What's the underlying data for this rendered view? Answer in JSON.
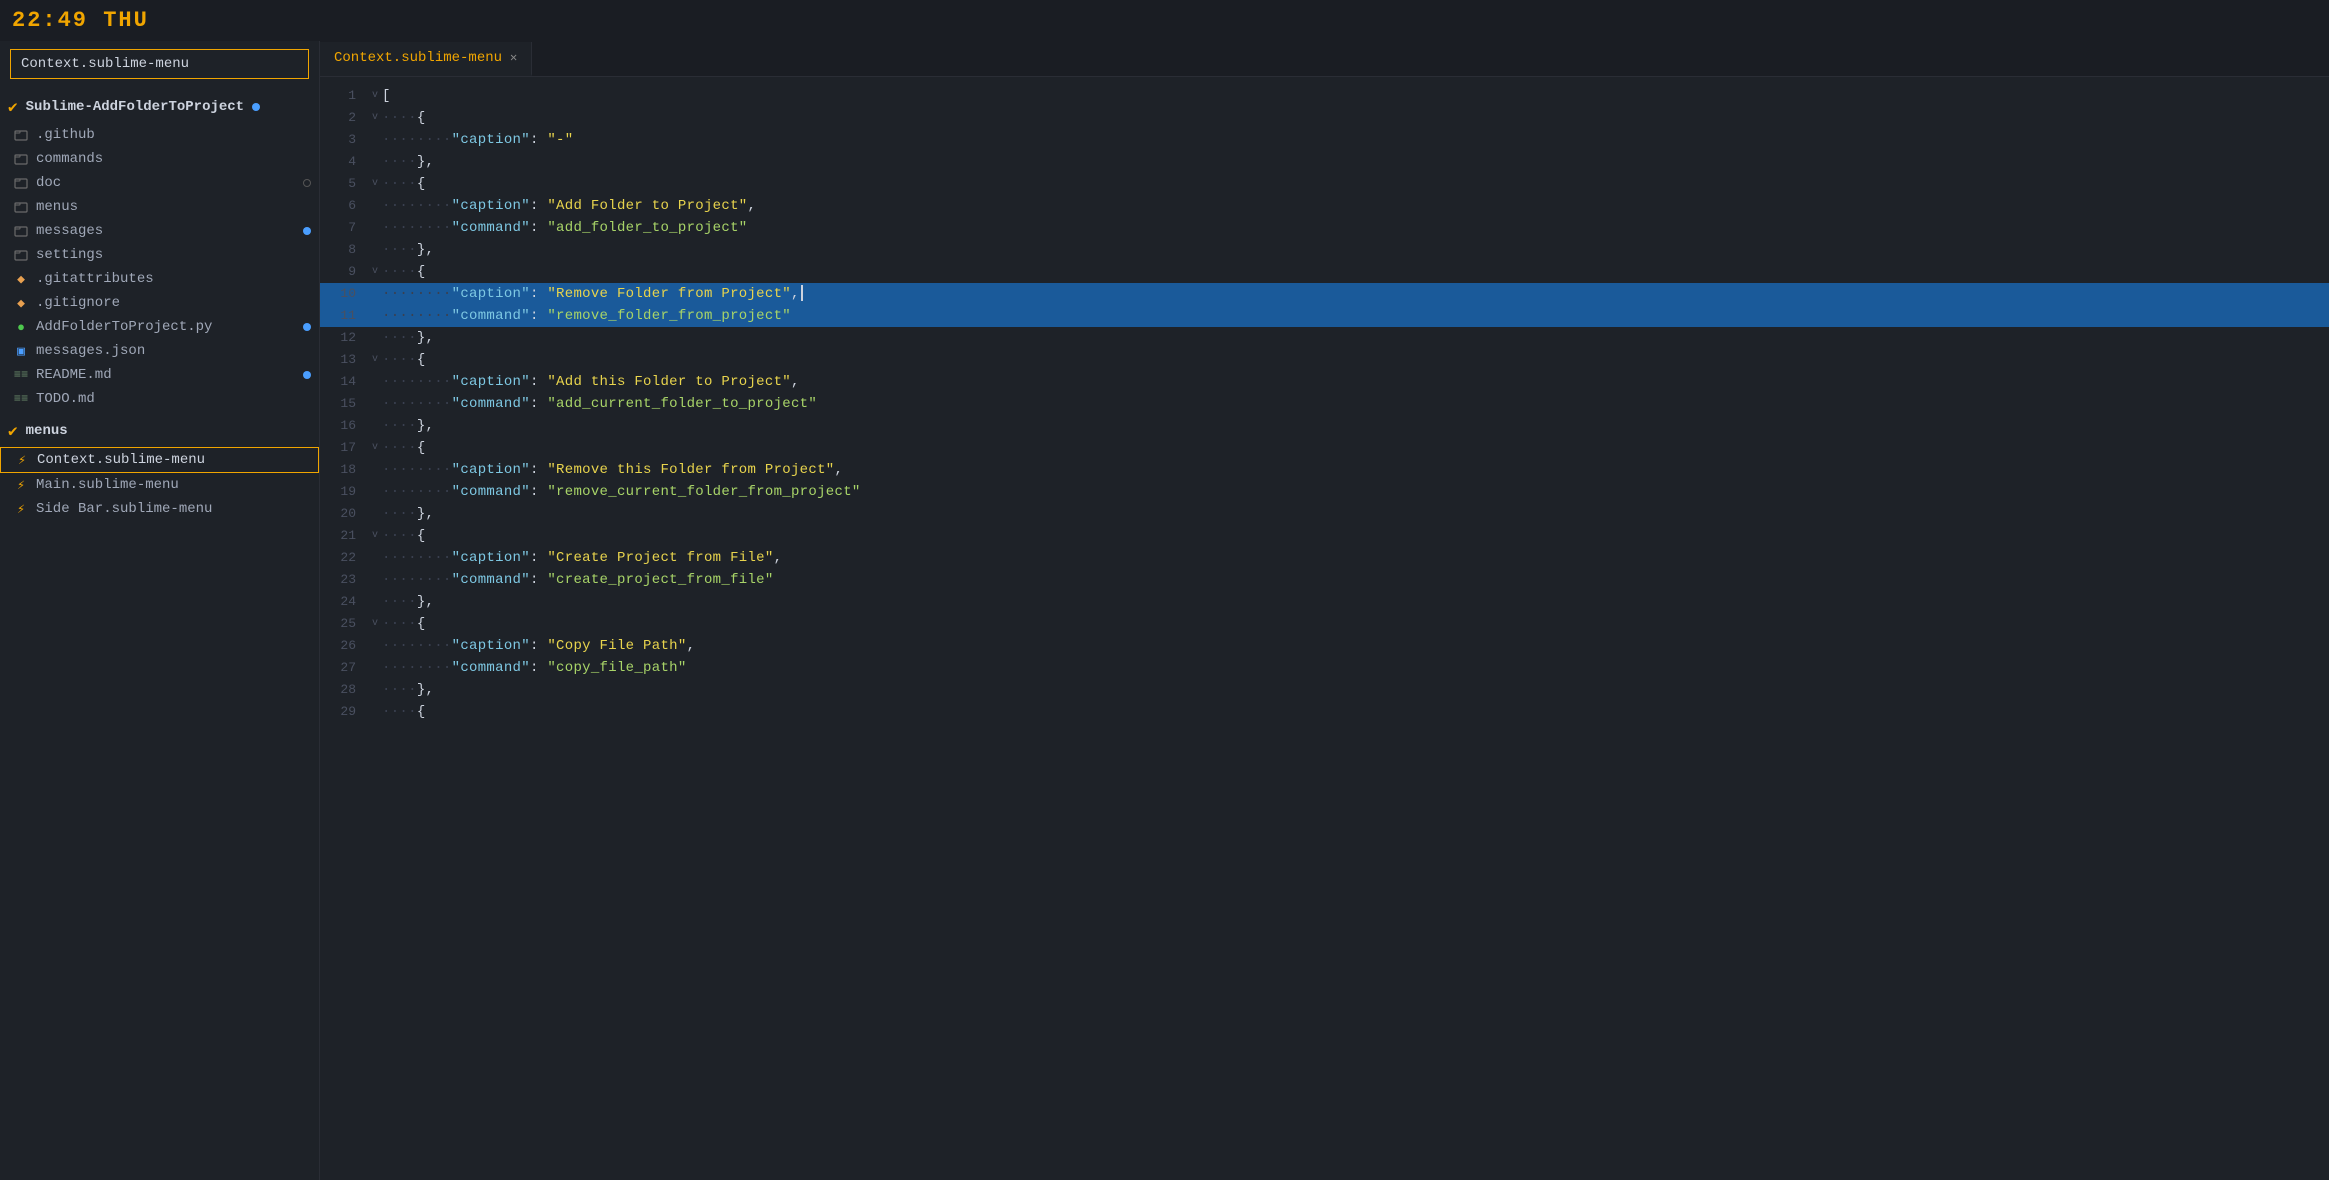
{
  "topbar": {
    "clock": "22:49 THU"
  },
  "sidebar": {
    "search_placeholder": "Context.sublime-menu",
    "search_value": "Context.sublime-menu",
    "root_folder": {
      "name": "Sublime-AddFolderToProject",
      "has_badge": true
    },
    "files": [
      {
        "id": "github",
        "type": "folder-square",
        "label": ".github",
        "indent": 1,
        "badge": null
      },
      {
        "id": "commands",
        "type": "folder-square",
        "label": "commands",
        "indent": 1,
        "badge": null
      },
      {
        "id": "doc",
        "type": "folder-square",
        "label": "doc",
        "indent": 1,
        "badge": "empty"
      },
      {
        "id": "menus",
        "type": "folder-square",
        "label": "menus",
        "indent": 1,
        "badge": null
      },
      {
        "id": "messages",
        "type": "folder-square",
        "label": "messages",
        "indent": 1,
        "badge": "blue"
      },
      {
        "id": "settings",
        "type": "folder-square",
        "label": "settings",
        "indent": 1,
        "badge": null
      },
      {
        "id": "gitattributes",
        "type": "git",
        "label": ".gitattributes",
        "indent": 1,
        "badge": null
      },
      {
        "id": "gitignore",
        "type": "git",
        "label": ".gitignore",
        "indent": 1,
        "badge": null
      },
      {
        "id": "addfolder-py",
        "type": "python",
        "label": "AddFolderToProject.py",
        "indent": 1,
        "badge": "blue"
      },
      {
        "id": "messages-json",
        "type": "json",
        "label": "messages.json",
        "indent": 1,
        "badge": null
      },
      {
        "id": "readme",
        "type": "md",
        "label": "README.md",
        "indent": 1,
        "badge": "blue"
      },
      {
        "id": "todo",
        "type": "md",
        "label": "TODO.md",
        "indent": 1,
        "badge": null
      }
    ],
    "menus_section": {
      "name": "menus"
    },
    "menu_files": [
      {
        "id": "context-menu",
        "label": "Context.sublime-menu",
        "active": true
      },
      {
        "id": "main-menu",
        "label": "Main.sublime-menu",
        "active": false
      },
      {
        "id": "sidebar-menu",
        "label": "Side Bar.sublime-menu",
        "active": false
      }
    ]
  },
  "tabs": [
    {
      "id": "context-tab",
      "label": "Context.sublime-menu",
      "active": true,
      "closable": true
    }
  ],
  "code_lines": [
    {
      "num": 1,
      "fold": "v",
      "content": "[",
      "highlight": false,
      "tokens": [
        {
          "t": "bracket",
          "v": "["
        }
      ]
    },
    {
      "num": 2,
      "fold": "v",
      "content": "    {",
      "highlight": false
    },
    {
      "num": 3,
      "fold": null,
      "content": "        \"caption\": \"-\"",
      "highlight": false
    },
    {
      "num": 4,
      "fold": null,
      "content": "    },",
      "highlight": false
    },
    {
      "num": 5,
      "fold": "v",
      "content": "    {",
      "highlight": false
    },
    {
      "num": 6,
      "fold": null,
      "content": "        \"caption\": \"Add Folder to Project\",",
      "highlight": false
    },
    {
      "num": 7,
      "fold": null,
      "content": "        \"command\": \"add_folder_to_project\"",
      "highlight": false
    },
    {
      "num": 8,
      "fold": null,
      "content": "    },",
      "highlight": false
    },
    {
      "num": 9,
      "fold": "v",
      "content": "    {",
      "highlight": false
    },
    {
      "num": 10,
      "fold": null,
      "content": "        \"caption\": \"Remove Folder from Project\",",
      "highlight": true,
      "cursor": true
    },
    {
      "num": 11,
      "fold": null,
      "content": "        \"command\": \"remove_folder_from_project\"",
      "highlight": true
    },
    {
      "num": 12,
      "fold": null,
      "content": "    },",
      "highlight": false
    },
    {
      "num": 13,
      "fold": "v",
      "content": "    {",
      "highlight": false
    },
    {
      "num": 14,
      "fold": null,
      "content": "        \"caption\": \"Add this Folder to Project\",",
      "highlight": false
    },
    {
      "num": 15,
      "fold": null,
      "content": "        \"command\": \"add_current_folder_to_project\"",
      "highlight": false
    },
    {
      "num": 16,
      "fold": null,
      "content": "    },",
      "highlight": false
    },
    {
      "num": 17,
      "fold": "v",
      "content": "    {",
      "highlight": false
    },
    {
      "num": 18,
      "fold": null,
      "content": "        \"caption\": \"Remove this Folder from Project\",",
      "highlight": false
    },
    {
      "num": 19,
      "fold": null,
      "content": "        \"command\": \"remove_current_folder_from_project\"",
      "highlight": false
    },
    {
      "num": 20,
      "fold": null,
      "content": "    },",
      "highlight": false
    },
    {
      "num": 21,
      "fold": "v",
      "content": "    {",
      "highlight": false
    },
    {
      "num": 22,
      "fold": null,
      "content": "        \"caption\": \"Create Project from File\",",
      "highlight": false
    },
    {
      "num": 23,
      "fold": null,
      "content": "        \"command\": \"create_project_from_file\"",
      "highlight": false
    },
    {
      "num": 24,
      "fold": null,
      "content": "    },",
      "highlight": false
    },
    {
      "num": 25,
      "fold": "v",
      "content": "    {",
      "highlight": false
    },
    {
      "num": 26,
      "fold": null,
      "content": "        \"caption\": \"Copy File Path\",",
      "highlight": false
    },
    {
      "num": 27,
      "fold": null,
      "content": "        \"command\": \"copy_file_path\"",
      "highlight": false
    },
    {
      "num": 28,
      "fold": null,
      "content": "    },",
      "highlight": false
    },
    {
      "num": 29,
      "fold": null,
      "content": "    {",
      "highlight": false
    }
  ]
}
